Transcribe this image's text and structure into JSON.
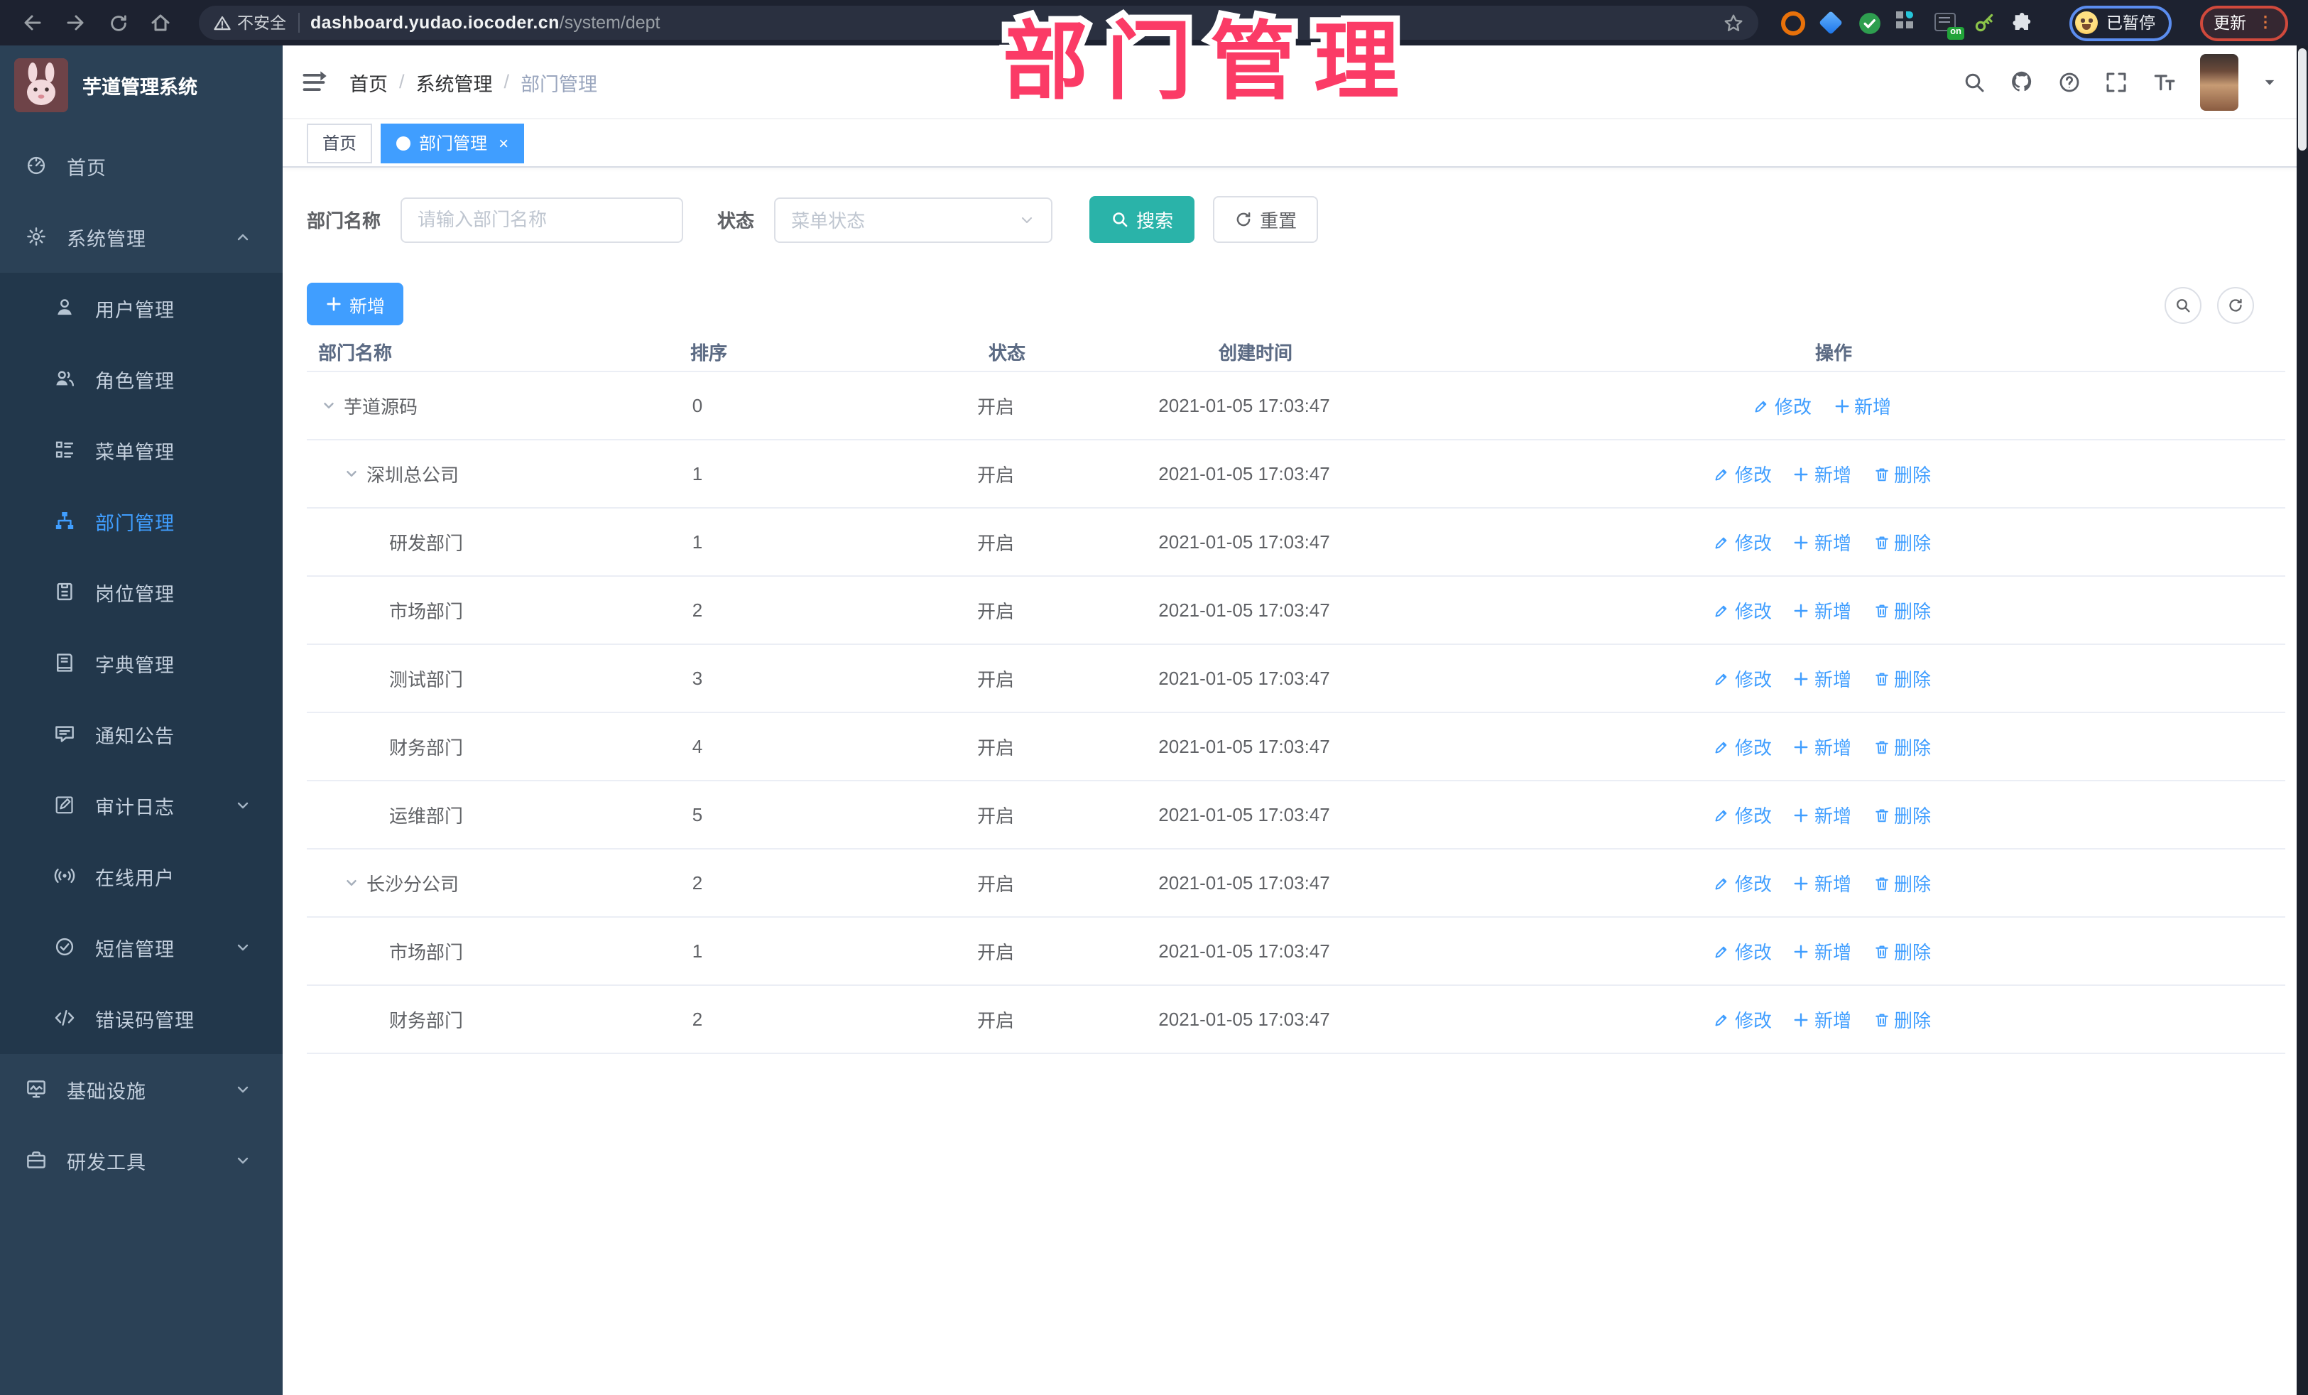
{
  "browser": {
    "security_label": "不安全",
    "url_host": "dashboard.yudao.iocoder.cn",
    "url_path": "/system/dept",
    "extension_badge": "on",
    "profile_status": "已暂停",
    "update_label": "更新",
    "update_menu": "⋮"
  },
  "watermark": "部门管理",
  "sidebar": {
    "title": "芋道管理系统",
    "items": [
      {
        "label": "首页",
        "icon": "dashboard-icon",
        "type": "mi-top"
      },
      {
        "label": "系统管理",
        "icon": "gear-icon",
        "type": "mi-top",
        "chevron_up": true
      },
      {
        "label": "用户管理",
        "icon": "user-icon",
        "type": "mi-sub"
      },
      {
        "label": "角色管理",
        "icon": "users-icon",
        "type": "mi-sub"
      },
      {
        "label": "菜单管理",
        "icon": "menu-list-icon",
        "type": "mi-sub"
      },
      {
        "label": "部门管理",
        "icon": "org-tree-icon",
        "type": "mi-sub",
        "active": true
      },
      {
        "label": "岗位管理",
        "icon": "badge-icon",
        "type": "mi-sub"
      },
      {
        "label": "字典管理",
        "icon": "book-icon",
        "type": "mi-sub"
      },
      {
        "label": "通知公告",
        "icon": "announcement-icon",
        "type": "mi-sub"
      },
      {
        "label": "审计日志",
        "icon": "log-icon",
        "type": "mi-sub",
        "chevron_down": true
      },
      {
        "label": "在线用户",
        "icon": "online-icon",
        "type": "mi-sub"
      },
      {
        "label": "短信管理",
        "icon": "sms-icon",
        "type": "mi-sub",
        "chevron_down": true
      },
      {
        "label": "错误码管理",
        "icon": "code-icon",
        "type": "mi-sub"
      },
      {
        "label": "基础设施",
        "icon": "monitor-icon",
        "type": "mi-top",
        "chevron_down": true
      },
      {
        "label": "研发工具",
        "icon": "toolbox-icon",
        "type": "mi-top",
        "chevron_down": true
      }
    ]
  },
  "header": {
    "breadcrumb": [
      "首页",
      "系统管理",
      "部门管理"
    ],
    "breadcrumb_sep": "/"
  },
  "tabs": [
    {
      "label": "首页"
    },
    {
      "label": "部门管理",
      "active": true,
      "closable": true,
      "close_glyph": "×"
    }
  ],
  "filters": {
    "name_label": "部门名称",
    "name_placeholder": "请输入部门名称",
    "status_label": "状态",
    "status_placeholder": "菜单状态",
    "search_label": "搜索",
    "reset_label": "重置"
  },
  "toolbar": {
    "add_label": "新增"
  },
  "table": {
    "columns": [
      "部门名称",
      "排序",
      "状态",
      "创建时间",
      "操作"
    ],
    "action_labels": {
      "modify": "修改",
      "add": "新增",
      "delete": "删除"
    },
    "rows": [
      {
        "name": "芋道源码",
        "level": 0,
        "expandable": true,
        "sort": "0",
        "status": "开启",
        "created": "2021-01-05 17:03:47",
        "can_delete": false
      },
      {
        "name": "深圳总公司",
        "level": 1,
        "expandable": true,
        "sort": "1",
        "status": "开启",
        "created": "2021-01-05 17:03:47",
        "can_delete": true
      },
      {
        "name": "研发部门",
        "level": 2,
        "expandable": false,
        "sort": "1",
        "status": "开启",
        "created": "2021-01-05 17:03:47",
        "can_delete": true
      },
      {
        "name": "市场部门",
        "level": 2,
        "expandable": false,
        "sort": "2",
        "status": "开启",
        "created": "2021-01-05 17:03:47",
        "can_delete": true
      },
      {
        "name": "测试部门",
        "level": 2,
        "expandable": false,
        "sort": "3",
        "status": "开启",
        "created": "2021-01-05 17:03:47",
        "can_delete": true
      },
      {
        "name": "财务部门",
        "level": 2,
        "expandable": false,
        "sort": "4",
        "status": "开启",
        "created": "2021-01-05 17:03:47",
        "can_delete": true
      },
      {
        "name": "运维部门",
        "level": 2,
        "expandable": false,
        "sort": "5",
        "status": "开启",
        "created": "2021-01-05 17:03:47",
        "can_delete": true
      },
      {
        "name": "长沙分公司",
        "level": 1,
        "expandable": true,
        "sort": "2",
        "status": "开启",
        "created": "2021-01-05 17:03:47",
        "can_delete": true
      },
      {
        "name": "市场部门",
        "level": 2,
        "expandable": false,
        "sort": "1",
        "status": "开启",
        "created": "2021-01-05 17:03:47",
        "can_delete": true
      },
      {
        "name": "财务部门",
        "level": 2,
        "expandable": false,
        "sort": "2",
        "status": "开启",
        "created": "2021-01-05 17:03:47",
        "can_delete": true
      }
    ]
  }
}
